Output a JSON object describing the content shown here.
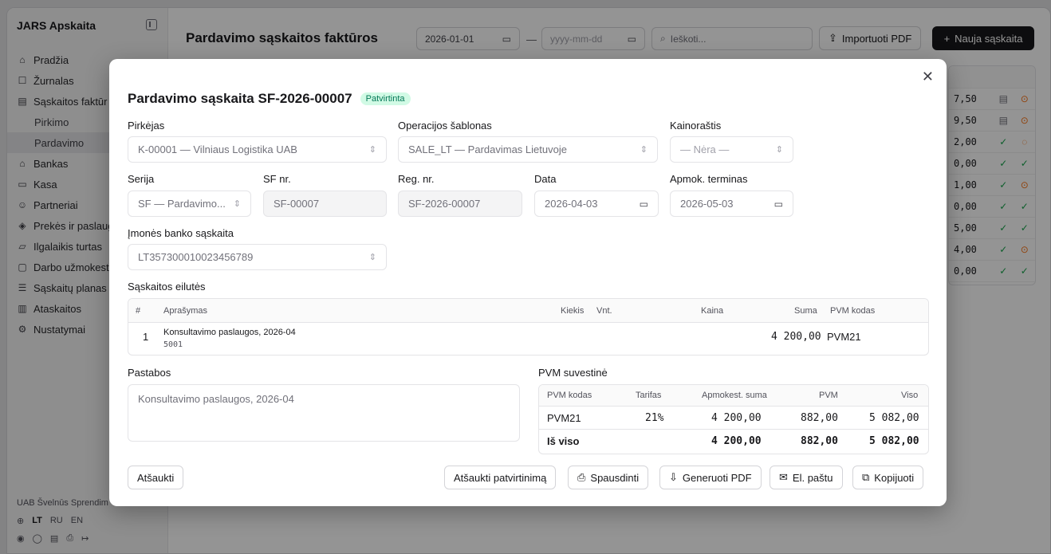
{
  "sidebar": {
    "brand": "JARS Apskaita",
    "items": [
      {
        "icon": "⌂",
        "label": "Pradžia"
      },
      {
        "icon": "☐",
        "label": "Žurnalas"
      },
      {
        "icon": "▤",
        "label": "Sąskaitos faktūr"
      },
      {
        "label": "Pirkimo"
      },
      {
        "label": "Pardavimo"
      },
      {
        "icon": "⌂",
        "label": "Bankas"
      },
      {
        "icon": "▭",
        "label": "Kasa"
      },
      {
        "icon": "☺",
        "label": "Partneriai"
      },
      {
        "icon": "◈",
        "label": "Prekės ir paslaug"
      },
      {
        "icon": "▱",
        "label": "Ilgalaikis turtas"
      },
      {
        "icon": "▢",
        "label": "Darbo užmokest"
      },
      {
        "icon": "☰",
        "label": "Sąskaitų planas"
      },
      {
        "icon": "▥",
        "label": "Ataskaitos"
      },
      {
        "icon": "⚙",
        "label": "Nustatymai"
      }
    ],
    "company": "UAB Švelnūs Sprendim",
    "langs": [
      "LT",
      "RU",
      "EN"
    ]
  },
  "page": {
    "title": "Pardavimo sąskaitos faktūros",
    "date_from": "2026-01-01",
    "dash": "—",
    "date_to_placeholder": "yyyy-mm-dd",
    "search_placeholder": "Ieškoti...",
    "import_label": "Importuoti PDF",
    "new_label": "Nauja sąskaita"
  },
  "bg_rows": [
    {
      "amt": "7,50",
      "a": "▤",
      "b": "⊙",
      "c": "#f97316"
    },
    {
      "amt": "9,50",
      "a": "▤",
      "b": "⊙",
      "c": "#f97316"
    },
    {
      "amt": "2,00",
      "a": "✓",
      "b": "◌",
      "c": "#f97316"
    },
    {
      "amt": "0,00",
      "a": "✓",
      "b": "✓",
      "c": "#16a34a"
    },
    {
      "amt": "1,00",
      "a": "✓",
      "b": "⊙",
      "c": "#f97316"
    },
    {
      "amt": "0,00",
      "a": "✓",
      "b": "✓",
      "c": "#16a34a"
    },
    {
      "amt": "5,00",
      "a": "✓",
      "b": "✓",
      "c": "#16a34a"
    },
    {
      "amt": "4,00",
      "a": "✓",
      "b": "⊙",
      "c": "#f97316"
    },
    {
      "amt": "0,00",
      "a": "✓",
      "b": "✓",
      "c": "#16a34a"
    }
  ],
  "modal": {
    "title": "Pardavimo sąskaita SF-2026-00007",
    "status": "Patvirtinta",
    "buyer_label": "Pirkėjas",
    "buyer_value": "K-00001 — Vilniaus Logistika UAB",
    "template_label": "Operacijos šablonas",
    "template_value": "SALE_LT — Pardavimas Lietuvoje",
    "pricelist_label": "Kainoraštis",
    "pricelist_value": "— Nėra —",
    "series_label": "Serija",
    "series_value": "SF — Pardavimo...",
    "sfnr_label": "SF nr.",
    "sfnr_value": "SF-00007",
    "regnr_label": "Reg. nr.",
    "regnr_value": "SF-2026-00007",
    "date_label": "Data",
    "date_value": "2026-04-03",
    "due_label": "Apmok. terminas",
    "due_value": "2026-05-03",
    "bank_label": "Įmonės banko sąskaita",
    "bank_value": "LT357300010023456789",
    "lines_label": "Sąskaitos eilutės",
    "lines_headers": {
      "num": "#",
      "desc": "Aprašymas",
      "qty": "Kiekis",
      "unit": "Vnt.",
      "price": "Kaina",
      "sum": "Suma",
      "vat": "PVM kodas"
    },
    "lines": [
      {
        "num": "1",
        "desc": "Konsultavimo paslaugos, 2026-04",
        "code": "5001",
        "sum": "4 200,00",
        "vat": "PVM21"
      }
    ],
    "notes_label": "Pastabos",
    "notes_value": "Konsultavimo paslaugos, 2026-04",
    "vat_label": "PVM suvestinė",
    "vat_headers": {
      "code": "PVM kodas",
      "rate": "Tarifas",
      "base": "Apmokest. suma",
      "vat": "PVM",
      "total": "Viso"
    },
    "vat_row": {
      "code": "PVM21",
      "rate": "21%",
      "base": "4 200,00",
      "vat": "882,00",
      "total": "5 082,00"
    },
    "vat_total": {
      "code": "Iš viso",
      "base": "4 200,00",
      "vat": "882,00",
      "total": "5 082,00"
    },
    "cancel_label": "Atšaukti",
    "unconfirm_label": "Atšaukti patvirtinimą",
    "print_label": "Spausdinti",
    "pdf_label": "Generuoti PDF",
    "email_label": "El. paštu",
    "copy_label": "Kopijuoti"
  }
}
